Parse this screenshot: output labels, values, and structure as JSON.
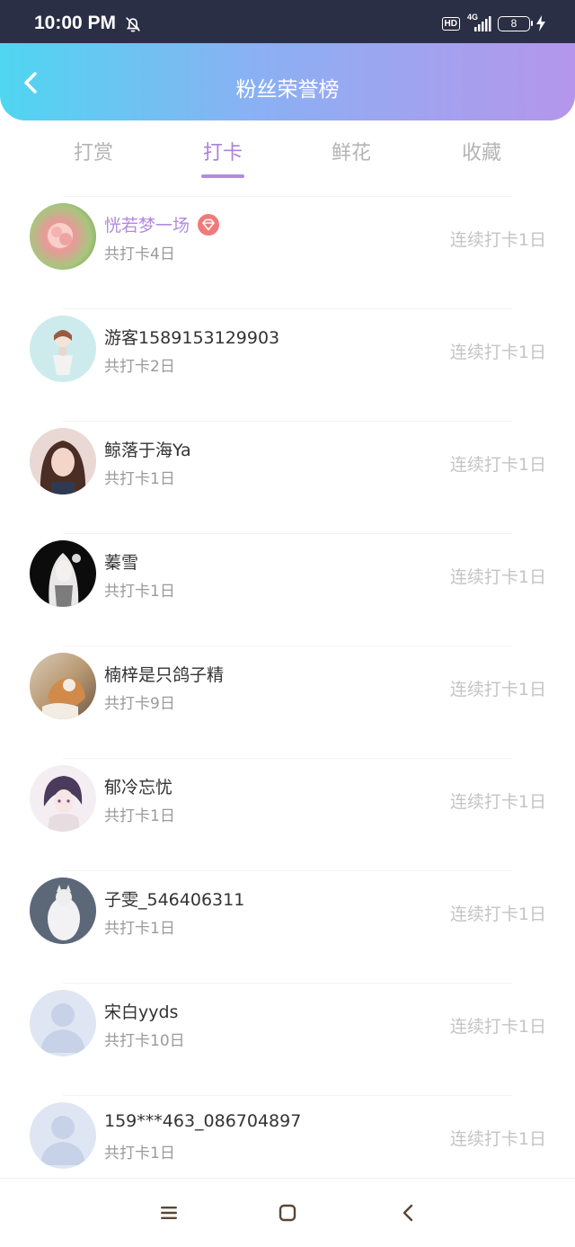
{
  "status_bar": {
    "time": "10:00 PM",
    "hd": "HD",
    "network": "4G",
    "battery": "8"
  },
  "header": {
    "title": "粉丝荣誉榜"
  },
  "tabs": [
    {
      "label": "打赏"
    },
    {
      "label": "打卡"
    },
    {
      "label": "鲜花"
    },
    {
      "label": "收藏"
    }
  ],
  "active_tab": "打卡",
  "fans": [
    {
      "name": "恍若梦一场",
      "total": "共打卡4日",
      "streak": "连续打卡1日"
    },
    {
      "name": "游客1589153129903",
      "total": "共打卡2日",
      "streak": "连续打卡1日"
    },
    {
      "name": "鲸落于海Ya",
      "total": "共打卡1日",
      "streak": "连续打卡1日"
    },
    {
      "name": "蓁雪",
      "total": "共打卡1日",
      "streak": "连续打卡1日"
    },
    {
      "name": "楠梓是只鸽子精",
      "total": "共打卡9日",
      "streak": "连续打卡1日"
    },
    {
      "name": "郁冷忘忧",
      "total": "共打卡1日",
      "streak": "连续打卡1日"
    },
    {
      "name": "子雯_546406311",
      "total": "共打卡1日",
      "streak": "连续打卡1日"
    },
    {
      "name": "宋白yyds",
      "total": "共打卡10日",
      "streak": "连续打卡1日"
    },
    {
      "name": "159***463_086704897",
      "total": "共打卡1日",
      "streak": "连续打卡1日"
    }
  ],
  "colors": {
    "accent": "#b28be0",
    "header_start": "#4fd6f1",
    "header_end": "#b596ec",
    "vip_badge": "#f07a7a"
  }
}
